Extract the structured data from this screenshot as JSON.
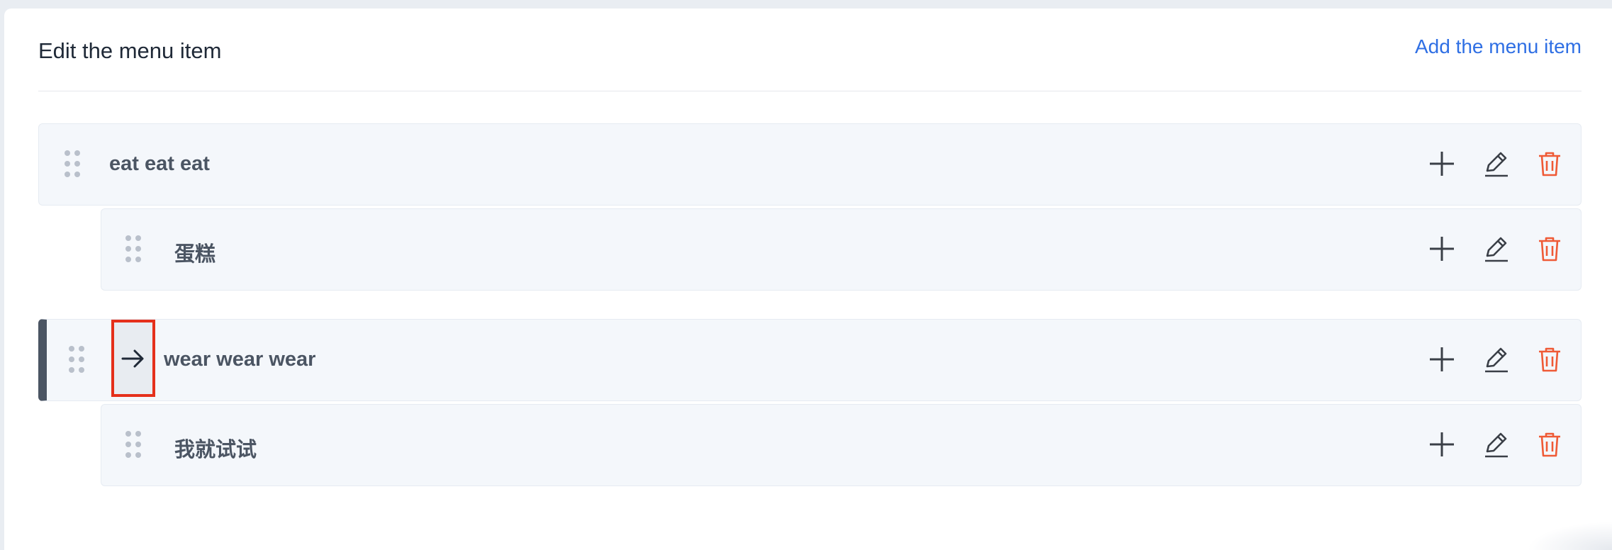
{
  "header": {
    "title": "Edit the menu item",
    "add_link": "Add the menu item"
  },
  "menu_items": [
    {
      "label": "eat eat eat",
      "level": 0
    },
    {
      "label": "蛋糕",
      "level": 1
    },
    {
      "label": "wear wear wear",
      "level": 0,
      "active": true
    },
    {
      "label": "我就试试",
      "level": 1
    }
  ],
  "icons": {
    "drag": "drag-handle-icon",
    "add": "plus-icon",
    "edit": "pencil-icon",
    "delete": "trash-icon",
    "move": "arrow-right-icon"
  },
  "colors": {
    "link": "#2f6fe4",
    "delete": "#ef5a36",
    "highlight_border": "#e5301b",
    "active_bar": "#4b5563"
  }
}
